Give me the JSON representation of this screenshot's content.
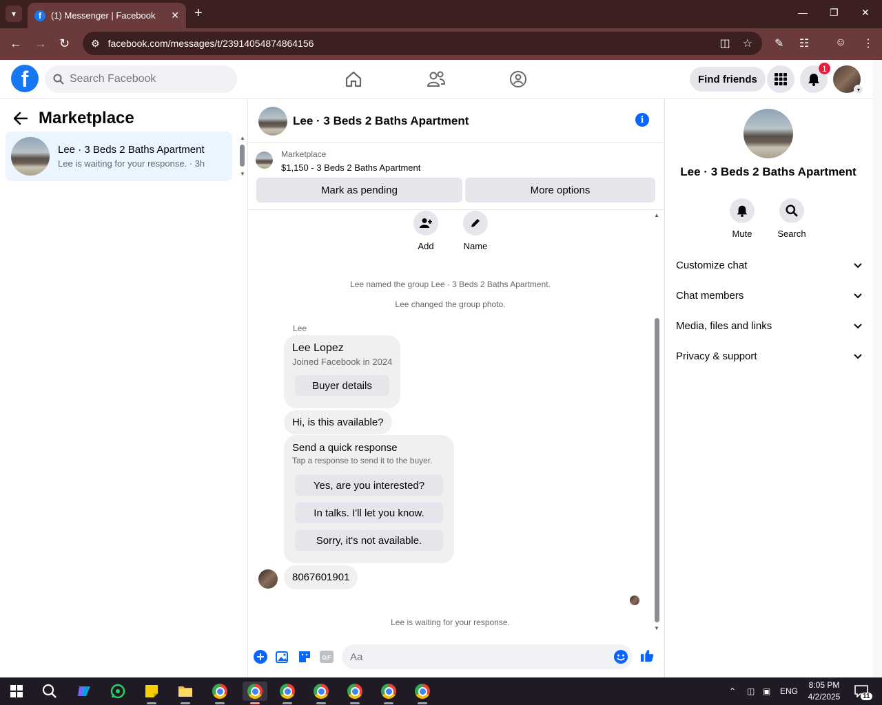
{
  "browser": {
    "tab_title": "(1) Messenger | Facebook",
    "url": "facebook.com/messages/t/23914054874864156"
  },
  "fb_header": {
    "search_placeholder": "Search Facebook",
    "find_friends_label": "Find friends",
    "notification_count": "1"
  },
  "left_panel": {
    "title": "Marketplace",
    "conversation": {
      "name": "Lee · 3 Beds 2 Baths Apartment",
      "preview": "Lee is waiting for your response. · 3h"
    }
  },
  "chat": {
    "header_name": "Lee · 3 Beds 2 Baths Apartment",
    "listing": {
      "label": "Marketplace",
      "price_title": "$1,150 - 3 Beds 2 Baths Apartment",
      "mark_pending_label": "Mark as pending",
      "more_options_label": "More options"
    },
    "actions": [
      {
        "label": "Add",
        "icon": "add-person-icon"
      },
      {
        "label": "Name",
        "icon": "pencil-icon"
      }
    ],
    "system_messages": [
      "Lee named the group Lee · 3 Beds 2 Baths Apartment.",
      "Lee changed the group photo."
    ],
    "sender_label": "Lee",
    "buyer_card": {
      "name": "Lee Lopez",
      "joined": "Joined Facebook in 2024",
      "button_label": "Buyer details"
    },
    "message_1": "Hi, is this available?",
    "quick_response": {
      "title": "Send a quick response",
      "subtitle": "Tap a response to send it to the buyer.",
      "options": [
        "Yes, are you interested?",
        "In talks. I'll let you know.",
        "Sorry, it's not available."
      ]
    },
    "message_2": "8067601901",
    "waiting_text": "Lee is waiting for your response.",
    "composer_placeholder": "Aa",
    "accent_color": "#0866ff"
  },
  "right_panel": {
    "name": "Lee · 3 Beds 2 Baths Apartment",
    "actions": [
      {
        "label": "Mute",
        "icon": "bell-icon"
      },
      {
        "label": "Search",
        "icon": "search-icon"
      }
    ],
    "sections": [
      "Customize chat",
      "Chat members",
      "Media, files and links",
      "Privacy & support"
    ]
  },
  "taskbar": {
    "language": "ENG",
    "time": "8:05 PM",
    "date": "4/2/2025",
    "notification_count": "11"
  }
}
